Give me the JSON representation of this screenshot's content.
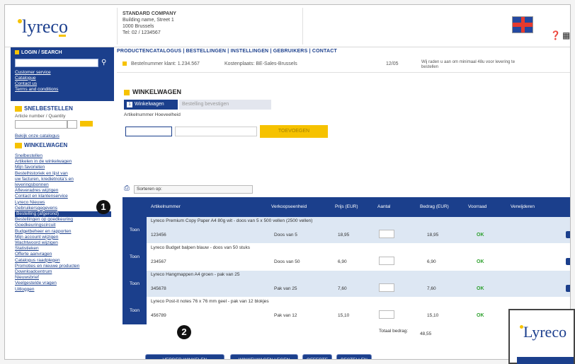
{
  "header": {
    "logo": "lyreco",
    "company": "STANDARD COMPANY",
    "address_lines": [
      "Building name, Street 1",
      "1000 Brussels",
      "Tel: 02 / 1234567"
    ]
  },
  "sidebar": {
    "login_title": "LOGIN / SEARCH",
    "login_links": [
      "Customer service",
      "Catalogue",
      "Contact us",
      "Terms and conditions"
    ],
    "quick_order_title": "SNELBESTELLEN",
    "quick_order_hint": "Article number / Quantity",
    "catalog_link": "Bekijk onze catalogus",
    "cart_title": "WINKELWAGEN",
    "items": [
      "Snelbestellen",
      "Artikelen in de winkelwagen",
      "Mijn favorieten",
      "Bestelhistoriek en lijst van",
      "uw facturen, kredietnota's en",
      "leveringsbonnen",
      "Afleveradres wijzigen",
      "Contact en klantenservice",
      "Lyreco Nieuws",
      "Gebruikersgegevens",
      "Bestelling (afgerond)",
      "Bestellingen op goedkeuring",
      "Goedkeuringscircuit",
      "Budgetbeheer en rapporten",
      "Mijn account wijzigen",
      "Wachtwoord wijzigen",
      "Statistieken",
      "Offerte aanvragen",
      "Catalogus raadplegen",
      "Promoties en nieuwe producten",
      "Downloadcentrum",
      "Nieuwsbrief",
      "Veelgestelde vragen",
      "Uitloggen"
    ]
  },
  "topnav": "PRODUCTENCATALOGUS | BESTELLINGEN | INSTELLINGEN | GEBRUIKERS | CONTACT",
  "crumb": {
    "account": "Bestelnummer klant: 1.234.567",
    "cost_center": "Kostenplaats: BE-Sales-Brussels",
    "date": "12/05",
    "info": "Wij raden u aan om minimaal 48u voor levering te bestellen"
  },
  "cart": {
    "title": "WINKELWAGEN",
    "tab_active_num": "1",
    "tab_active": "Winkelwagen",
    "tab_inactive": "Bestelling bevestigen",
    "field_label": "Artikelnummer   Hoeveelheid",
    "add_button": "TOEVOEGEN",
    "filter_label": "Sorteren op:"
  },
  "table": {
    "headers": [
      "Artikelnummer",
      "Verkoopseenheid",
      "Prijs (EUR)",
      "Aantal",
      "Bedrag (EUR)",
      "Voorraad",
      "Verwijderen"
    ],
    "view_label": "Toon",
    "rows": [
      {
        "desc": "Lyreco Premium Copy Paper A4 80g wit - doos van 5 x 500 vellen (2500 vellen)",
        "code": "123456",
        "unit": "Doos van 5",
        "price": "18,95",
        "amount": "18,95",
        "stock": "OK"
      },
      {
        "desc": "Lyreco Budget balpen blauw - doos van 50 stuks",
        "code": "234567",
        "unit": "Doos van 50",
        "price": "6,90",
        "amount": "6,90",
        "stock": "OK"
      },
      {
        "desc": "Lyreco Hangmappen A4 groen - pak van 25",
        "code": "345678",
        "unit": "Pak van 25",
        "price": "7,60",
        "amount": "7,60",
        "stock": "OK"
      },
      {
        "desc": "Lyreco Post-it notes 76 x 76 mm geel - pak van 12 blokjes",
        "code": "456789",
        "unit": "Pak van 12",
        "price": "15,10",
        "amount": "15,10",
        "stock": "OK"
      }
    ],
    "total_label": "Totaal bedrag:",
    "total_value": "48,55"
  },
  "buttons": [
    "VERDER WINKELEN",
    "WINKELWAGEN LEGEN",
    "OFFERTE",
    "BESTELLEN"
  ],
  "callouts": [
    "1",
    "2"
  ],
  "inset_logo": "Lyreco",
  "colors": {
    "brand_blue": "#1b3f8c",
    "brand_yellow": "#f6c200",
    "stock_green": "#2ca02c"
  }
}
